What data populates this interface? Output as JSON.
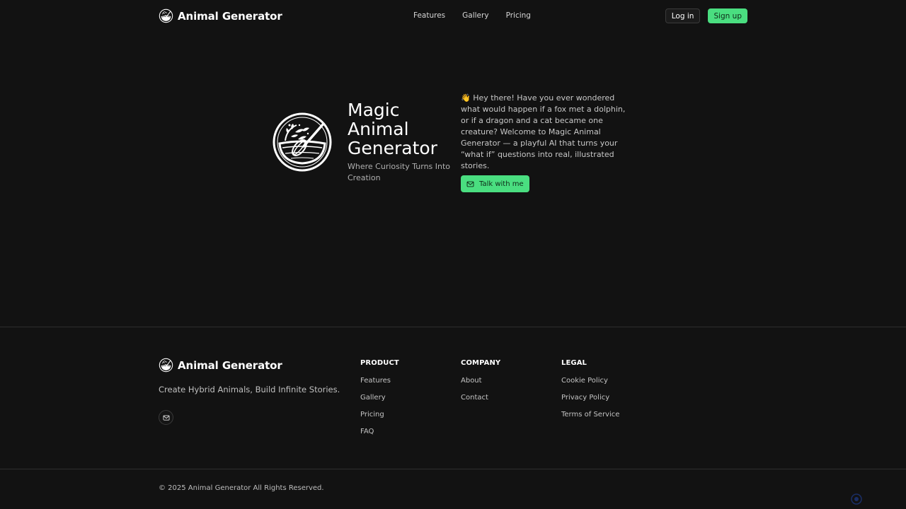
{
  "brand": {
    "name": "Animal Generator"
  },
  "nav": {
    "links": [
      "Features",
      "Gallery",
      "Pricing"
    ],
    "login_label": "Log in",
    "signup_label": "Sign up"
  },
  "hero": {
    "title_lines": [
      "Magic",
      "Animal",
      "Generator"
    ],
    "tagline": "Where Curiosity Turns Into Creation",
    "intro": "👋 Hey there! Have you ever wondered what would happen if a fox met a dolphin, or if a dragon and a cat became one creature? Welcome to Magic Animal Generator — a playful AI that turns your “what if” questions into real, illustrated stories.",
    "cta_label": "Talk with me"
  },
  "footer": {
    "tagline": "Create Hybrid Animals, Build Infinite Stories.",
    "columns": [
      {
        "heading": "PRODUCT",
        "links": [
          "Features",
          "Gallery",
          "Pricing",
          "FAQ"
        ]
      },
      {
        "heading": "COMPANY",
        "links": [
          "About",
          "Contact"
        ]
      },
      {
        "heading": "LEGAL",
        "links": [
          "Cookie Policy",
          "Privacy Policy",
          "Terms of Service"
        ]
      }
    ],
    "copyright": "© 2025 Animal Generator All Rights Reserved."
  },
  "colors": {
    "background": "#121212",
    "accent": "#4ade80",
    "divider": "#2e2e2e"
  },
  "icons": {
    "logo": "magic-bowl-whisk-icon",
    "mail": "mail-icon"
  }
}
